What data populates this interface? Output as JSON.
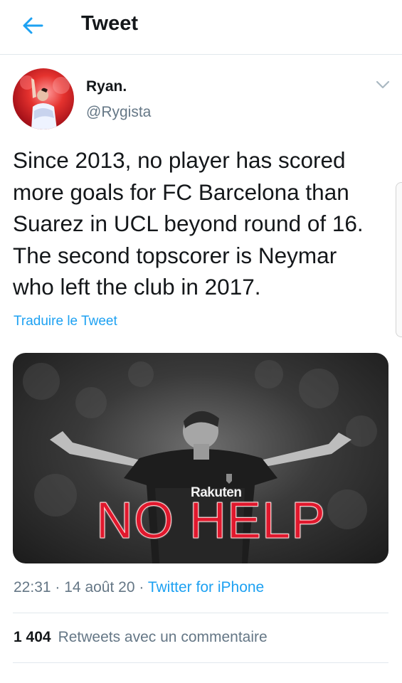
{
  "header": {
    "title": "Tweet",
    "back_icon": "back-arrow-icon",
    "accent_color": "#1da1f2"
  },
  "tweet": {
    "author": {
      "display_name": "Ryan.",
      "handle": "@Rygista",
      "avatar": "avatar-photo"
    },
    "more_icon": "chevron-down-icon",
    "text": "Since 2013, no player has scored\nmore goals for FC Barcelona than\nSuarez in UCL beyond round of 16.\nThe second topscorer is Neymar\nwho left the club in 2017.",
    "translate_label": "Traduire le Tweet",
    "media": {
      "sponsor_text": "Rakuten",
      "overlay_text": "NO HELP",
      "overlay_color": "#e0182d"
    },
    "time": "22:31",
    "separator": "·",
    "date": "14 août 20",
    "client": "Twitter for iPhone",
    "stats": {
      "count": "1 404",
      "label": "Retweets avec un commentaire"
    }
  }
}
